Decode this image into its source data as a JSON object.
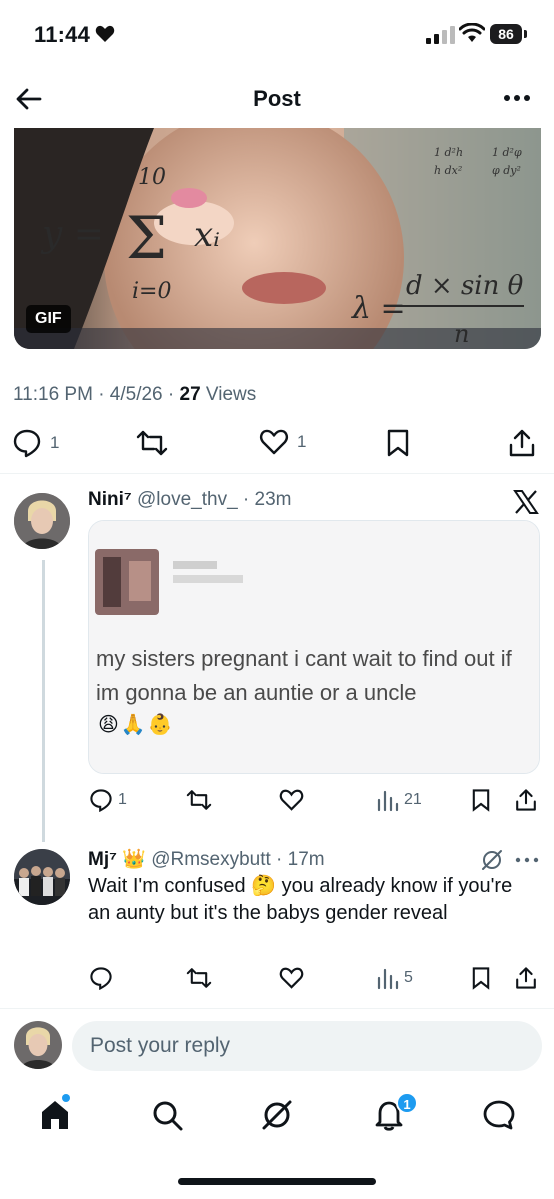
{
  "status_bar": {
    "time": "11:44",
    "battery": "86"
  },
  "header": {
    "title": "Post"
  },
  "gif": {
    "badge": "GIF",
    "math_sum": "y = Σ xᵢ",
    "math_top": "10",
    "math_bottom": "i=0",
    "math_lambda": "λ =",
    "math_num": "d × sin θ",
    "math_den": "n"
  },
  "post_meta": {
    "time_date": "11:16 PM · 4/5/26 · ",
    "views_count": "27",
    "views_label": " Views"
  },
  "post_actions": {
    "replies": "1",
    "likes": "1"
  },
  "reply1": {
    "name": "Nini⁷",
    "handle": "@love_thv_ · 23m",
    "quote_text": "my sisters pregnant i cant wait to find out if im gonna be an auntie or a uncle",
    "quote_emojis": "😩🙏👶",
    "replies": "1",
    "views": "21"
  },
  "reply2": {
    "name": "Mj⁷",
    "crown": "👑",
    "handle": "@Rmsexybutt · 17m",
    "text": "Wait I'm confused 🤔 you already know if you're an aunty but it's the babys gender reveal",
    "views": "5"
  },
  "composer": {
    "placeholder": "Post your reply"
  },
  "nav": {
    "notifications_count": "1"
  },
  "colors": {
    "accent": "#1d9bf0",
    "text": "#0f1419",
    "muted": "#536471"
  }
}
